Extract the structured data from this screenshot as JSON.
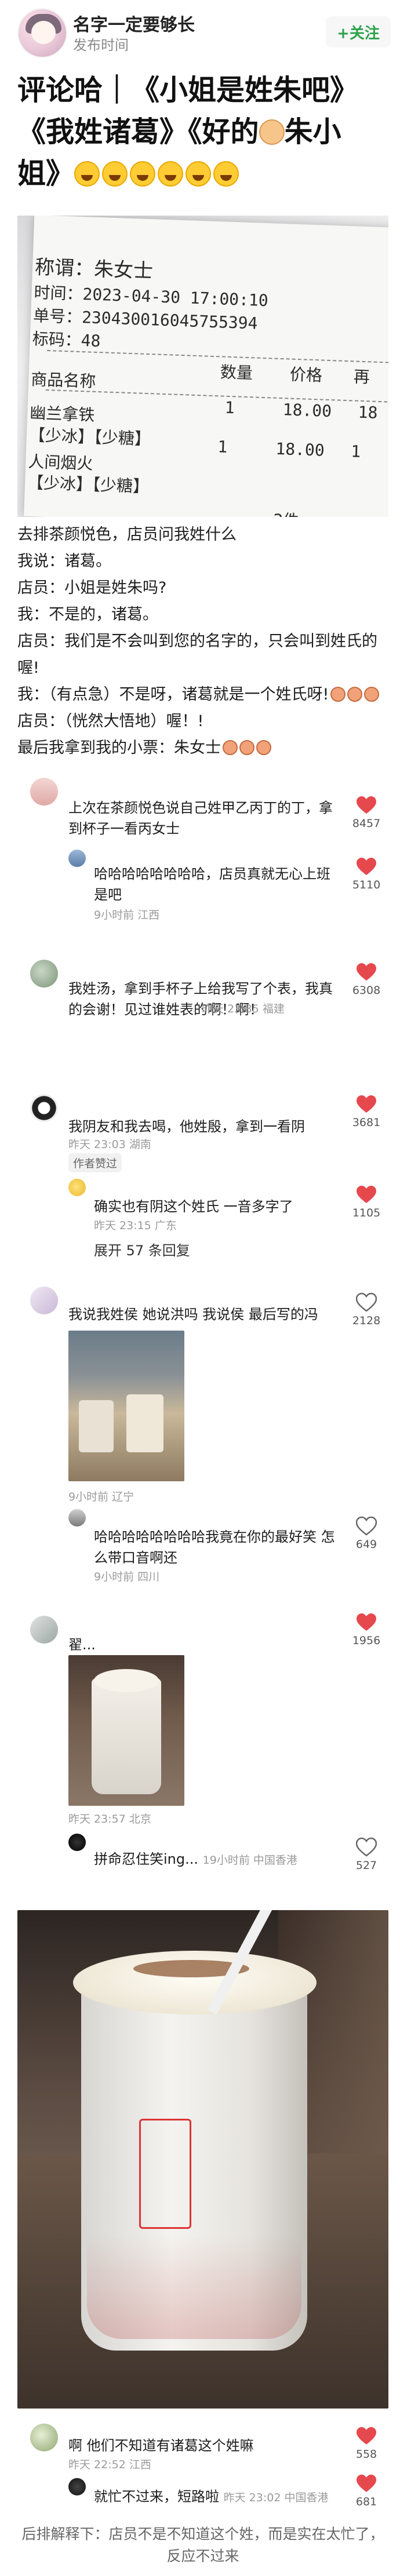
{
  "header": {
    "username": "名字一定要够长",
    "subtitle": "发布时间",
    "follow_label": "+关注"
  },
  "post": {
    "title_line1": "评论哈｜《小姐是姓朱吧》",
    "title_line2": "《我姓诸葛》《好的",
    "title_line2b": "朱小",
    "title_line3": "姐》",
    "receipt": {
      "header_partial": "称谓：朱女士",
      "time": "时间：2023-04-30 17:00:10",
      "order_no": "单号：230430016045755394",
      "tag_no": "标码：48",
      "col_qty": "数量",
      "col_price": "价格",
      "col_amount": "再",
      "col_name": "商品名称",
      "item1_name": "幽兰拿铁",
      "item1_opts": "【少冰】【少糖】",
      "item1_qty": "1",
      "item1_price": "18.00",
      "item1_amt": "18",
      "item2_name": "人间烟火",
      "item2_opts": "【少冰】【少糖】",
      "item2_qty": "1",
      "item2_price": "18.00",
      "item2_amt": "1",
      "bottom": "2件"
    },
    "body": [
      "去排茶颜悦色，店员问我姓什么",
      "我说：诸葛。",
      "店员：小姐是姓朱吗?",
      "我：不是的，诸葛。",
      "店员：我们是不会叫到您的名字的，只会叫到姓氏的喔!",
      "我：（有点急）不是呀，诸葛就是一个姓氏呀!",
      "店员：（恍然大悟地）喔！!",
      "最后我拿到我的小票：朱女士"
    ]
  },
  "comments": [
    {
      "text": "上次在茶颜悦色说自己姓甲乙丙丁的丁，拿到杯子一看丙女士",
      "likes": "8457",
      "reply_text": "哈哈哈哈哈哈哈哈，店员真就无心上班是吧",
      "reply_meta": "9小时前 江西",
      "reply_likes": "5110"
    },
    {
      "text": "我姓汤，拿到手杯子上给我写了个表，我真的会谢！见过谁姓表的啊！啊！",
      "meta": "昨天 23:35 福建",
      "likes": "6308"
    },
    {
      "text": "我阴友和我去喝，他姓殷，拿到一看阴",
      "meta": "昨天 23:03 湖南",
      "author_tag": "作者赞过",
      "likes": "3681",
      "reply_text": "确实也有阴这个姓氏 一音多字了",
      "reply_meta": "昨天 23:15 广东",
      "reply_likes": "1105",
      "expand": "展开 57 条回复"
    },
    {
      "text": "我说我姓侯 她说洪吗 我说侯 最后写的冯",
      "meta": "9小时前 辽宁",
      "likes": "2128",
      "reply_text": "哈哈哈哈哈哈哈哈我竟在你的最好笑 怎么带口音啊还",
      "reply_meta": "9小时前 四川",
      "reply_likes": "649"
    },
    {
      "text": "翟...",
      "meta": "昨天 23:57 北京",
      "likes": "1956",
      "reply_text": "拼命忍住笑ing...",
      "reply_meta": "19小时前 中国香港",
      "reply_likes": "527"
    },
    {
      "text": "啊 他们不知道有诸葛这个姓嘛",
      "meta": "昨天 22:52 江西",
      "likes": "558",
      "reply_text": "就忙不过来，短路啦",
      "reply_meta": "昨天 23:02 中国香港",
      "reply_likes": "681"
    }
  ],
  "footer": {
    "line1": "后排解释下：店员不是不知道这个姓，而是实在太忙了，",
    "line2": "反应不过来"
  },
  "colors": {
    "accent_green": "#2ca24a",
    "heart_red": "#e5484d",
    "meta_gray": "#9a9a9a"
  }
}
